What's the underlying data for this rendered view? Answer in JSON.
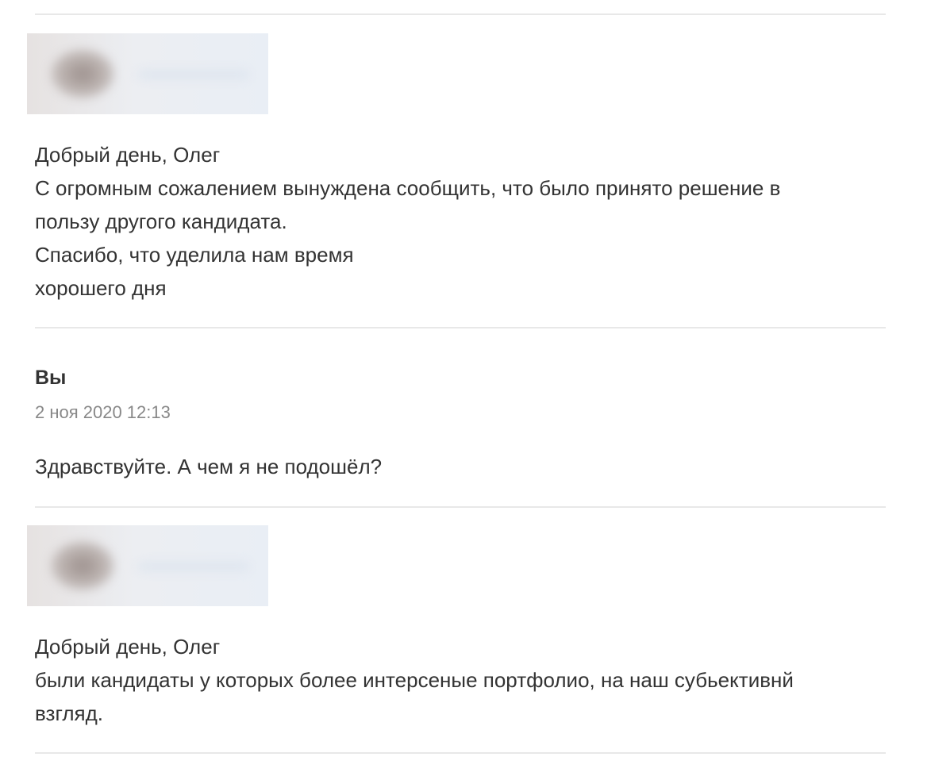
{
  "thread": {
    "messages": [
      {
        "sender": "",
        "lines": [
          "Добрый день, Олег",
          "С огромным сожалением вынуждена сообщить, что было принято решение в",
          "пользу другого кандидата.",
          "Спасибо, что уделила нам время",
          "хорошего дня"
        ]
      },
      {
        "sender": "Вы",
        "timestamp": "2 ноя 2020 12:13",
        "lines": [
          "Здравствуйте. А чем я не подошёл?"
        ]
      },
      {
        "sender": "",
        "lines": [
          "Добрый день, Олег",
          "были кандидаты у которых более интерсеные портфолио, на наш субьективнй",
          "взгляд."
        ]
      }
    ]
  }
}
